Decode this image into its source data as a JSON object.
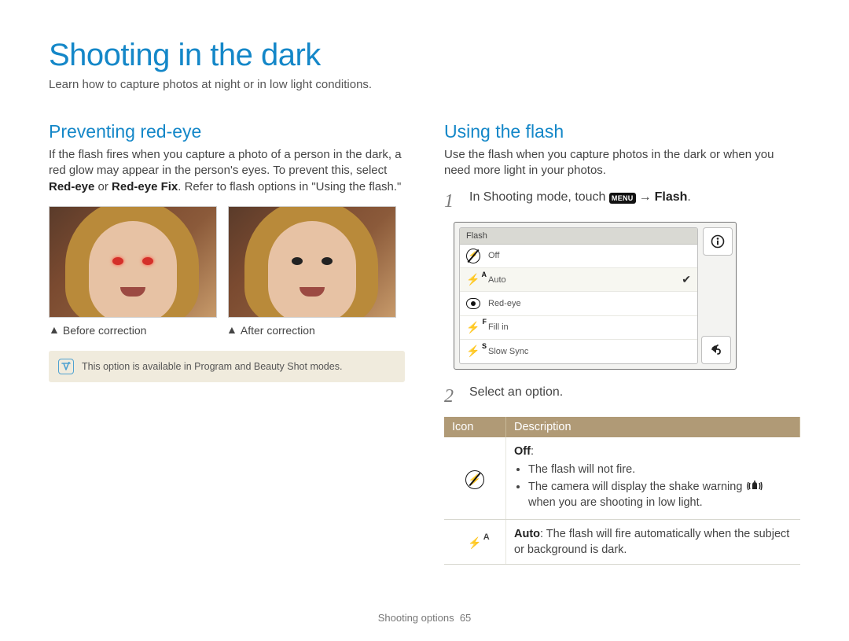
{
  "page": {
    "title": "Shooting in the dark",
    "subtitle": "Learn how to capture photos at night or in low light conditions."
  },
  "left": {
    "heading": "Preventing red-eye",
    "para_a": "If the flash fires when you capture a photo of a person in the dark, a red glow may appear in the person's eyes. To prevent this, select ",
    "para_bold1": "Red-eye",
    "para_mid": " or ",
    "para_bold2": "Red-eye Fix",
    "para_b": ". Refer to flash options in \"Using the flash.\"",
    "caption_before": "Before correction",
    "caption_after": "After correction",
    "note": "This option is available in Program and Beauty Shot modes."
  },
  "right": {
    "heading": "Using the flash",
    "intro": "Use the flash when you capture photos in the dark or when you need more light in your photos.",
    "step1_a": "In Shooting mode, touch ",
    "step1_menu": "MENU",
    "step1_b": "Flash",
    "step2": "Select an option.",
    "screen": {
      "title": "Flash",
      "items": [
        {
          "label": "Off"
        },
        {
          "label": "Auto",
          "selected": true
        },
        {
          "label": "Red-eye"
        },
        {
          "label": "Fill in"
        },
        {
          "label": "Slow Sync"
        }
      ]
    },
    "table": {
      "h_icon": "Icon",
      "h_desc": "Description",
      "rows": {
        "off": {
          "title": "Off",
          "b1": "The flash will not fire.",
          "b2a": "The camera will display the shake warning ",
          "b2b": " when you are shooting in low light."
        },
        "auto": {
          "title": "Auto",
          "text": ": The flash will fire automatically when the subject or background is dark."
        }
      }
    }
  },
  "footer": {
    "section": "Shooting options",
    "page_no": "65"
  }
}
